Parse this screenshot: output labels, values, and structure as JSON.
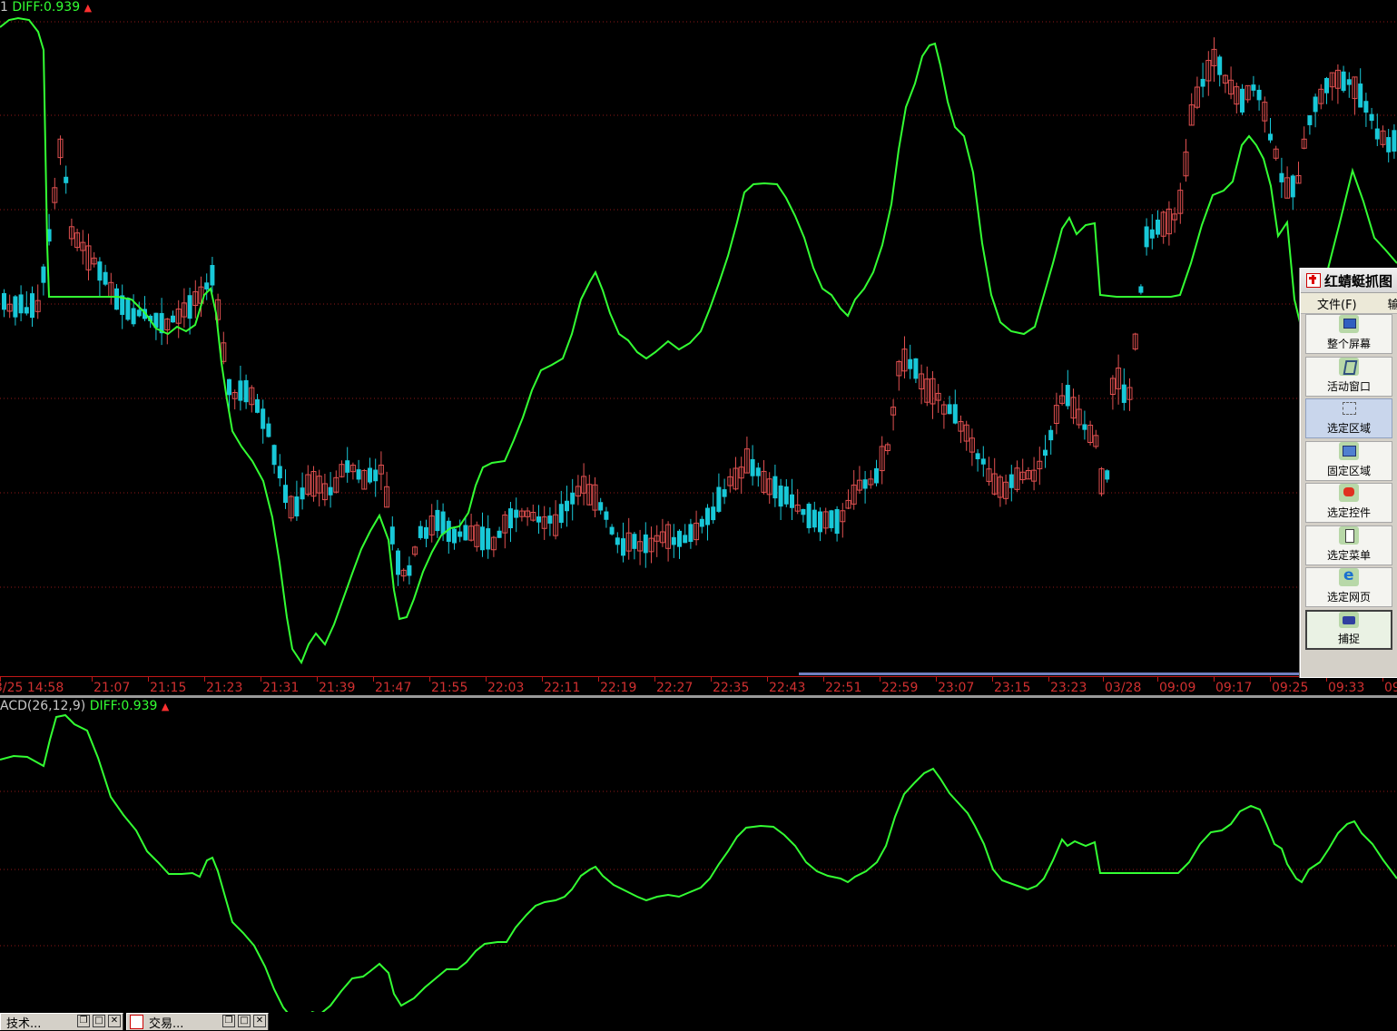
{
  "main_legend": {
    "label": "1",
    "diff": "DIFF:0.939"
  },
  "macd_legend": {
    "label": "ACD(26,12,9)",
    "diff": "DIFF:0.939"
  },
  "time_axis": {
    "labels": [
      "3/25 14:58",
      "21:07",
      "21:15",
      "21:23",
      "21:31",
      "21:39",
      "21:47",
      "21:55",
      "22:03",
      "22:11",
      "22:19",
      "22:27",
      "22:35",
      "22:43",
      "22:51",
      "22:59",
      "23:07",
      "23:15",
      "23:23",
      "03/28",
      "09:09",
      "09:17",
      "09:25",
      "09:33",
      "09:"
    ]
  },
  "capture_tool": {
    "title": "红蜻蜓抓图",
    "menu": [
      "文件(F)",
      "输"
    ],
    "tools": [
      {
        "label": "整个屏幕",
        "icon": "monitor-icon"
      },
      {
        "label": "活动窗口",
        "icon": "window-icon"
      },
      {
        "label": "选定区域",
        "icon": "region-icon"
      },
      {
        "label": "固定区域",
        "icon": "fixed-region-icon"
      },
      {
        "label": "选定控件",
        "icon": "control-icon"
      },
      {
        "label": "选定菜单",
        "icon": "menu-icon"
      },
      {
        "label": "选定网页",
        "icon": "web-icon"
      },
      {
        "label": "捕捉",
        "icon": "camera-icon"
      }
    ]
  },
  "taskbar": {
    "tasks": [
      {
        "label": "技术..."
      },
      {
        "label": "交易..."
      }
    ]
  },
  "colors": {
    "bull": "#e05050",
    "bear": "#18c8d8",
    "line": "#33ff33",
    "grid": "#901818",
    "axis": "#c01818"
  },
  "chart_data": [
    {
      "type": "candlestick",
      "title": "",
      "series": [
        {
          "name": "",
          "values": []
        }
      ],
      "description": "price candles with green DIFF overlay line",
      "grid": true
    },
    {
      "type": "line",
      "title": "ACD(26,12,9) DIFF:0.939",
      "series": [
        {
          "name": "DIFF",
          "values": []
        }
      ],
      "grid": true
    }
  ]
}
